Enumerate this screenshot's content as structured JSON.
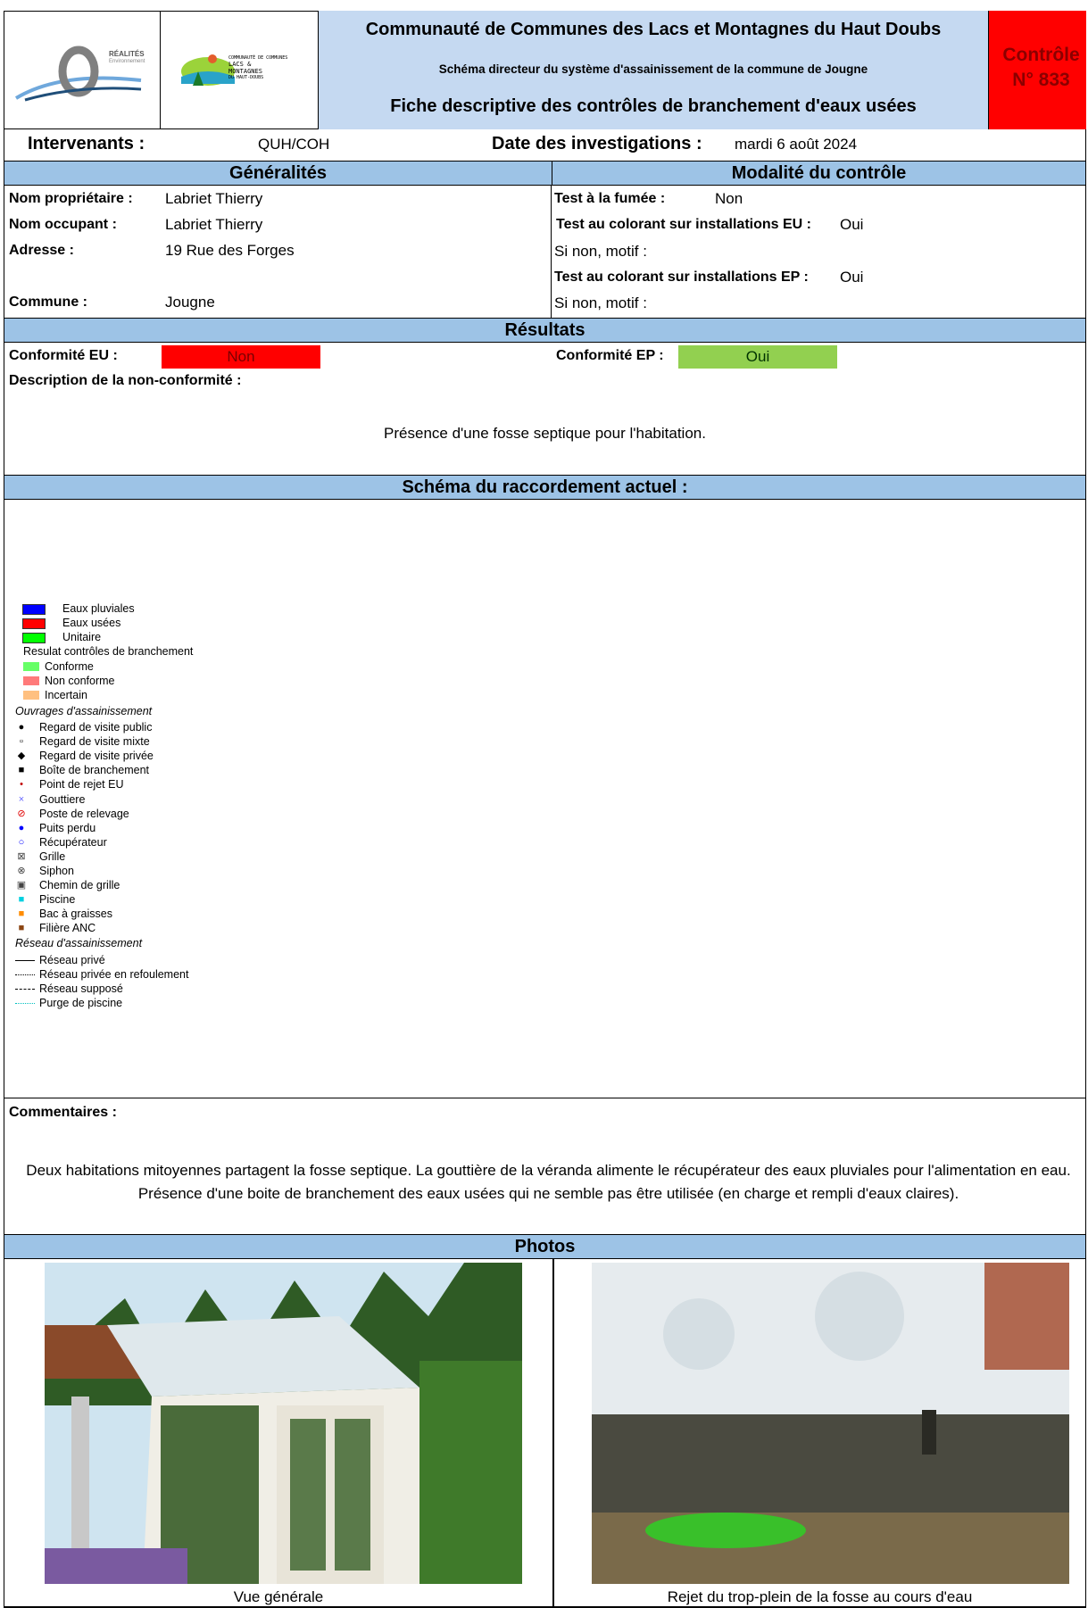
{
  "header": {
    "logo1_text": "RÉALITÉS",
    "logo1_sub": "Environnement",
    "logo2_lines": [
      "COMMUNAUTÉ DE COMMUNES",
      "LACS &",
      "MONTAGNES",
      "DU HAUT-DOUBS"
    ],
    "title": "Communauté de Communes des Lacs et Montagnes du Haut Doubs",
    "subtitle": "Schéma directeur du système d'assainissement de la commune de Jougne",
    "heading": "Fiche descriptive des contrôles de branchement d'eaux usées",
    "control_label": "Contrôle",
    "control_number": "N° 833"
  },
  "meta": {
    "intervenants_label": "Intervenants :",
    "intervenants_value": "QUH/COH",
    "date_label": "Date des investigations :",
    "date_value": "mardi 6 août 2024"
  },
  "generalites": {
    "title": "Généralités",
    "proprietaire_label": "Nom propriétaire :",
    "proprietaire_value": "Labriet Thierry",
    "occupant_label": "Nom occupant :",
    "occupant_value": "Labriet Thierry",
    "adresse_label": "Adresse :",
    "adresse_value": "19 Rue des Forges",
    "commune_label": "Commune :",
    "commune_value": "Jougne"
  },
  "modalite": {
    "title": "Modalité du contrôle",
    "fumee_label": "Test à la fumée :",
    "fumee_value": "Non",
    "eu_label": "Test au colorant sur installations EU :",
    "eu_value": "Oui",
    "motif1": "Si non, motif :",
    "ep_label": "Test au colorant sur installations EP :",
    "ep_value": "Oui",
    "motif2": "Si non, motif :"
  },
  "resultats": {
    "title": "Résultats",
    "eu_label": "Conformité EU :",
    "eu_value": "Non",
    "eu_color": "#ff0000",
    "ep_label": "Conformité EP :",
    "ep_value": "Oui",
    "ep_color": "#92d050",
    "desc_label": "Description de la non-conformité :",
    "desc_text": "Présence d'une fosse septique pour l'habitation."
  },
  "schema": {
    "title": "Schéma du raccordement actuel :",
    "legend": {
      "types": [
        {
          "label": "Eaux pluviales",
          "color": "#0000ff"
        },
        {
          "label": "Eaux usées",
          "color": "#ff0000"
        },
        {
          "label": "Unitaire",
          "color": "#00ff00"
        }
      ],
      "result_title": "Resulat contrôles de branchement",
      "results": [
        {
          "label": "Conforme",
          "color": "#66ff66"
        },
        {
          "label": "Non conforme",
          "color": "#ff7a7a"
        },
        {
          "label": "Incertain",
          "color": "#ffc080"
        }
      ],
      "ouvrages_title": "Ouvrages d'assainissement",
      "ouvrages": [
        {
          "label": "Regard de visite public",
          "icon": "filled-circle-icon",
          "glyph": "●",
          "color": "#000"
        },
        {
          "label": "Regard de visite mixte",
          "icon": "open-square-icon",
          "glyph": "▫",
          "color": "#000"
        },
        {
          "label": "Regard de visite privée",
          "icon": "diamond-icon",
          "glyph": "◆",
          "color": "#000"
        },
        {
          "label": "Boîte de branchement",
          "icon": "filled-square-icon",
          "glyph": "■",
          "color": "#000"
        },
        {
          "label": "Point de rejet EU",
          "icon": "dot-icon",
          "glyph": "•",
          "color": "#c00000"
        },
        {
          "label": "Gouttiere",
          "icon": "cross-icon",
          "glyph": "×",
          "color": "#6666ff"
        },
        {
          "label": "Poste de relevage",
          "icon": "no-entry-icon",
          "glyph": "⊘",
          "color": "#e00000"
        },
        {
          "label": "Puits perdu",
          "icon": "blue-circle-icon",
          "glyph": "●",
          "color": "#0000ff"
        },
        {
          "label": "Récupérateur",
          "icon": "ring-icon",
          "glyph": "○",
          "color": "#0000ff"
        },
        {
          "label": "Grille",
          "icon": "boxed-x-icon",
          "glyph": "⊠",
          "color": "#444"
        },
        {
          "label": "Siphon",
          "icon": "circled-x-icon",
          "glyph": "⊗",
          "color": "#444"
        },
        {
          "label": "Chemin de grille",
          "icon": "boxed-dot-icon",
          "glyph": "▣",
          "color": "#444"
        },
        {
          "label": "Piscine",
          "icon": "cyan-square-icon",
          "glyph": "■",
          "color": "#00d0e0"
        },
        {
          "label": "Bac à graisses",
          "icon": "orange-square-icon",
          "glyph": "■",
          "color": "#ff8c00"
        },
        {
          "label": "Filière ANC",
          "icon": "brown-square-icon",
          "glyph": "■",
          "color": "#8b4513"
        }
      ],
      "reseau_title": "Réseau d'assainissement",
      "reseaux": [
        {
          "label": "Réseau privé",
          "style": "solid",
          "color": "#000"
        },
        {
          "label": "Réseau privée en refoulement",
          "style": "dotted",
          "color": "#000"
        },
        {
          "label": "Réseau supposé",
          "style": "dashed",
          "color": "#000"
        },
        {
          "label": "Purge de piscine",
          "style": "dotted",
          "color": "#00c0c0"
        }
      ]
    }
  },
  "commentaires": {
    "label": "Commentaires :",
    "text": "Deux habitations mitoyennes partagent la fosse septique. La gouttière de la véranda alimente le récupérateur des eaux pluviales pour l'alimentation en eau. Présence d'une boite de branchement des eaux usées qui ne semble pas être utilisée (en charge et rempli d'eaux claires)."
  },
  "photos": {
    "title": "Photos",
    "left_caption": "Vue générale",
    "right_caption": "Rejet du trop-plein de la fosse au cours d'eau"
  }
}
